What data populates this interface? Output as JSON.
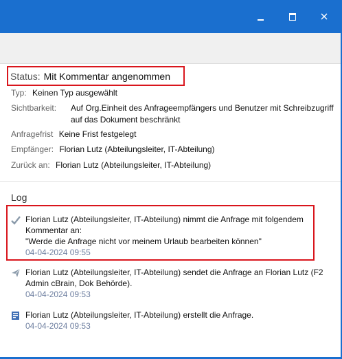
{
  "window": {
    "minimize_glyph": "minimize",
    "maximize_glyph": "maximize",
    "close_glyph": "×"
  },
  "details": {
    "status_label": "Status:",
    "status_value": "Mit Kommentar angenommen",
    "type_label": "Typ:",
    "type_value": "Keinen Typ ausgewählt",
    "visibility_label": "Sichtbarkeit:",
    "visibility_value": "Auf Org.Einheit des Anfrageempfängers und Benutzer mit Schreibzugriff auf das Dokument beschränkt",
    "deadline_label": "Anfragefrist",
    "deadline_value": "Keine Frist festgelegt",
    "recipient_label": "Empfänger:",
    "recipient_value": "Florian Lutz (Abteilungsleiter, IT-Abteilung)",
    "return_label": "Zurück an:",
    "return_value": "Florian Lutz (Abteilungsleiter, IT-Abteilung)"
  },
  "log": {
    "title": "Log",
    "entries": [
      {
        "icon": "check-icon",
        "text_line1": "Florian Lutz (Abteilungsleiter, IT-Abteilung) nimmt die Anfrage mit folgendem",
        "text_line2": "Kommentar an:",
        "text_line3": "\"Werde die Anfrage nicht vor meinem Urlaub bearbeiten können\"",
        "date": "04-04-2024 09:55"
      },
      {
        "icon": "send-icon",
        "text_line1": "Florian Lutz (Abteilungsleiter, IT-Abteilung) sendet die Anfrage an Florian Lutz (F2",
        "text_line2": "Admin cBrain, Dok Behörde).",
        "date": "04-04-2024 09:53"
      },
      {
        "icon": "document-icon",
        "text_line1": "Florian Lutz (Abteilungsleiter, IT-Abteilung) erstellt die Anfrage.",
        "date": "04-04-2024 09:53"
      }
    ]
  },
  "colors": {
    "titlebar": "#1a6fcf",
    "highlight": "#d9151c",
    "date_text": "#6e7fa0"
  }
}
